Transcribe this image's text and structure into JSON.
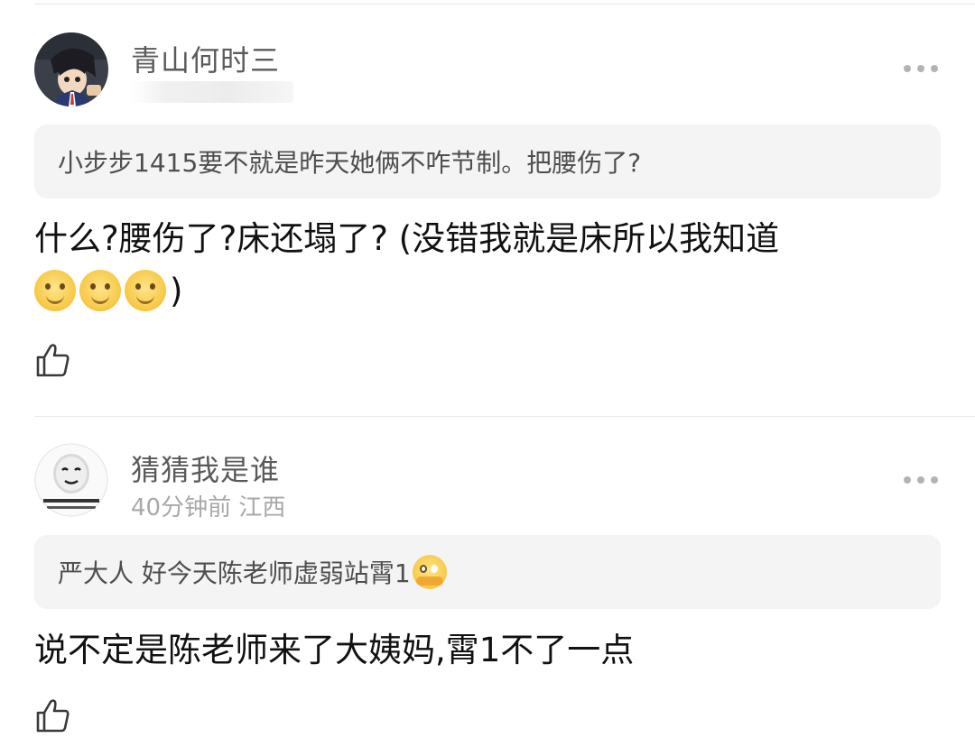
{
  "comments": [
    {
      "username": "青山何时三",
      "meta": "",
      "quote": {
        "author": "小步步1415",
        "text": "要不就是昨天她俩不咋节制。把腰伤了?"
      },
      "body": {
        "line1": "什么?腰伤了?床还塌了? (没错我就是床所以我知道",
        "emoji_count": 3,
        "line2_suffix": ")"
      },
      "avatar_icon": "anime-character-avatar"
    },
    {
      "username": "猜猜我是谁",
      "meta": "40分钟前 江西",
      "quote": {
        "author": "严大人 好",
        "text": "今天陈老师虚弱站霄1"
      },
      "body": {
        "text": "说不定是陈老师来了大姨妈,霄1不了一点"
      },
      "avatar_icon": "meme-face-avatar"
    }
  ],
  "icons": {
    "more": "more-dots-icon",
    "like": "thumbs-up-icon",
    "emoji": "slight-smile-emoji",
    "hug": "hugging-emoji"
  },
  "colors": {
    "username": "#5a5a5a",
    "meta": "#a8a8a8",
    "quote_bg": "#f4f4f4",
    "body_text": "#111111"
  }
}
